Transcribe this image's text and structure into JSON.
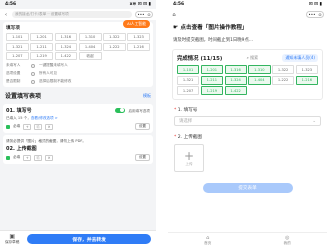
{
  "left": {
    "status": {
      "time": "4:56",
      "icons": "ⅹ⊜ ⊡ ⊡ ▮"
    },
    "url": "我的接龙/打卡/表单 ·· 设置填写项",
    "capsule": "•••",
    "ai_button": "AI人工智能",
    "card_title": "填写项",
    "grid": [
      "1-101",
      "1-201",
      "1-316",
      "1-310",
      "1-322",
      "1-323",
      "1-321",
      "1-211",
      "1-324",
      "1-404",
      "1-222",
      "1-216",
      "1-207",
      "1-219",
      "1-422",
      "收起"
    ],
    "radios": [
      {
        "label": "未填写人",
        "value": "一键提醒未填写人"
      },
      {
        "label": "选项设置",
        "value": "所有人可见"
      },
      {
        "label": "是否限制",
        "value": "选择后限制不能修改"
      }
    ],
    "section_title": "设置填写表项",
    "section_link": "模板",
    "q1": {
      "title": "01. 填写号",
      "toggle_label": "启用填写选项",
      "sub1": "已填入 15 个，",
      "sub1_link": "查看/修改选项 >",
      "sub2_check": "必填",
      "sub2_btns": [
        "+",
        "⎘",
        "✕"
      ],
      "sub2_setting": "设置"
    },
    "note": "请务必提供「图片」格式的截图，请勿上传 PDF。",
    "q2": {
      "title": "02. 上传截图",
      "opt_check": "必填",
      "opt_btns": [
        "+",
        "⎘",
        "✕"
      ],
      "opt_setting": "设置"
    },
    "bottom": {
      "draft": "保存草稿",
      "publish": "保存，并去转发"
    }
  },
  "right": {
    "status": {
      "time": "4:56",
      "icons": "⊡ ⊡ ▮"
    },
    "capsule": "•••",
    "banner": "点击查看「图片操作教程」",
    "desc": "请及时提交截图，时间截止到1日晚9点...",
    "card": {
      "title": "完成情况 (11/15)",
      "search": "搜索",
      "tag": "通知未填人员(4)"
    },
    "grid": [
      {
        "label": "1-101",
        "done": true
      },
      {
        "label": "1-201",
        "done": true
      },
      {
        "label": "1-316",
        "done": true
      },
      {
        "label": "1-310",
        "done": true
      },
      {
        "label": "1-322",
        "done": false
      },
      {
        "label": "1-323",
        "done": false
      },
      {
        "label": "1-321",
        "done": false
      },
      {
        "label": "1-211",
        "done": true
      },
      {
        "label": "1-324",
        "done": true
      },
      {
        "label": "1-404",
        "done": true
      },
      {
        "label": "1-222",
        "done": false
      },
      {
        "label": "1-216",
        "done": true
      },
      {
        "label": "1-207",
        "done": false
      },
      {
        "label": "1-219",
        "done": true
      },
      {
        "label": "1-422",
        "done": true
      }
    ],
    "q1": {
      "label": "1. 填写号",
      "placeholder": "请选择"
    },
    "q2": {
      "label": "2. 上传截图",
      "upload_caption": "上传"
    },
    "submit": "提交表单",
    "tabs": [
      {
        "icon": "⌂",
        "label": "首页"
      },
      {
        "icon": "◎",
        "label": "我的"
      }
    ],
    "colors": {
      "done": "#34b560",
      "accent": "#2f7cf6"
    }
  }
}
